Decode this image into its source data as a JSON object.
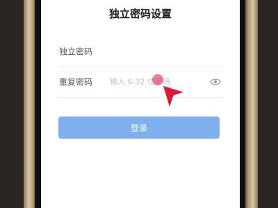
{
  "page": {
    "title": "独立密码设置"
  },
  "form": {
    "password": {
      "label": "独立密码",
      "value": "",
      "placeholder": ""
    },
    "confirm": {
      "label": "重复密码",
      "value": "",
      "placeholder": "输入 6-32 位密码"
    },
    "visibility_icon": "eye-icon"
  },
  "submit": {
    "label": "登录"
  },
  "colors": {
    "accent": "#7db0ec",
    "pointer": "#e0193a",
    "frame_gold": "#d9c8a4"
  }
}
